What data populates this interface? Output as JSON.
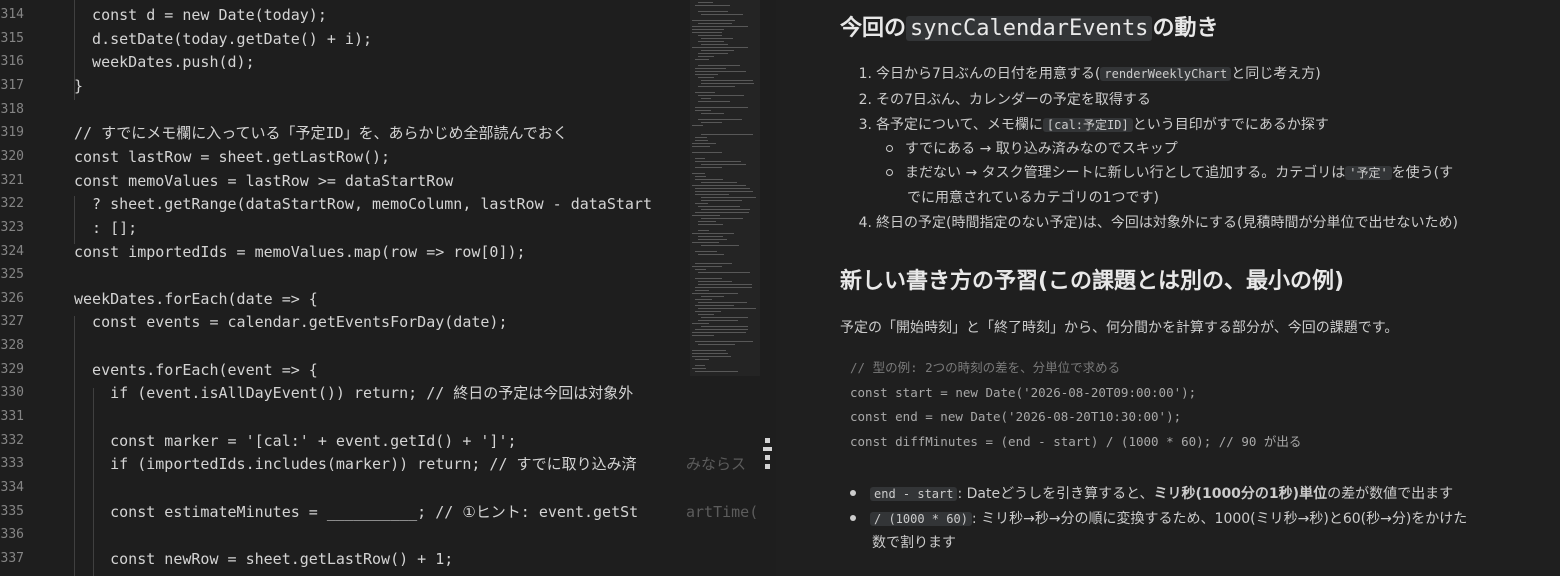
{
  "editor": {
    "line_numbers": [
      "314",
      "315",
      "316",
      "317",
      "318",
      "319",
      "320",
      "321",
      "322",
      "323",
      "324",
      "325",
      "326",
      "327",
      "328",
      "329",
      "330",
      "331",
      "332",
      "333",
      "334",
      "335",
      "336",
      "337"
    ],
    "lines": [
      "  const d = new Date(today);",
      "  d.setDate(today.getDate() + i);",
      "  weekDates.push(d);",
      "}",
      "",
      "// すでにメモ欄に入っている「予定ID」を、あらかじめ全部読んでおく",
      "const lastRow = sheet.getLastRow();",
      "const memoValues = lastRow >= dataStartRow",
      "  ? sheet.getRange(dataStartRow, memoColumn, lastRow - dataStart",
      "  : [];",
      "const importedIds = memoValues.map(row => row[0]);",
      "",
      "weekDates.forEach(date => {",
      "  const events = calendar.getEventsForDay(date);",
      "",
      "  events.forEach(event => {",
      "    if (event.isAllDayEvent()) return; // 終日の予定は今回は対象外",
      "",
      "    const marker = '[cal:' + event.getId() + ']';",
      "    if (importedIds.includes(marker)) return; // すでに取り込み済",
      "",
      "    const estimateMinutes = __________; // ①ヒント: event.getSt",
      "",
      "    const newRow = sheet.getLastRow() + 1;"
    ],
    "spill_text": {
      "line_333": "みならス",
      "line_335": "artTime("
    }
  },
  "preview": {
    "section1": {
      "title_before": "今回の",
      "title_code": "syncCalendarEvents",
      "title_after": "の動き",
      "steps": [
        {
          "num": "1.",
          "before": "今日から7日ぶんの日付を用意する(",
          "code": "renderWeeklyChart",
          "after": "と同じ考え方)"
        },
        {
          "num": "2.",
          "text": "その7日ぶん、カレンダーの予定を取得する"
        },
        {
          "num": "3.",
          "before": "各予定について、メモ欄に",
          "code": "[cal:予定ID]",
          "after": "という目印がすでにあるか探す"
        },
        {
          "num": "4.",
          "text": "終日の予定(時間指定のない予定)は、今回は対象外にする(見積時間が分単位で出せないため)"
        }
      ],
      "sub_items": [
        {
          "text": "すでにある → 取り込み済みなのでスキップ"
        },
        {
          "before": "まだない → タスク管理シートに新しい行として追加する。カテゴリは",
          "code": "'予定'",
          "after": "を使う(す",
          "cont": "でに用意されているカテゴリの1つです)"
        }
      ]
    },
    "section2": {
      "title": "新しい書き方の予習(この課題とは別の、最小の例)",
      "paragraph": "予定の「開始時刻」と「終了時刻」から、何分間かを計算する部分が、今回の課題です。",
      "code_lines": [
        "// 型の例: 2つの時刻の差を、分単位で求める",
        "const start = new Date('2026-08-20T09:00:00');",
        "const end = new Date('2026-08-20T10:30:00');",
        "const diffMinutes = (end - start) / (1000 * 60); // 90 が出る"
      ],
      "bullets": [
        {
          "code": "end - start",
          "text_before": ": Dateどうしを引き算すると、",
          "bold": "ミリ秒(1000分の1秒)単位",
          "text_after": "の差が数値で出ます"
        },
        {
          "code": "/ (1000 * 60)",
          "text": ": ミリ秒→秒→分の順に変換するため、1000(ミリ秒→秒)と60(秒→分)をかけた",
          "cont": "数で割ります"
        }
      ]
    }
  }
}
